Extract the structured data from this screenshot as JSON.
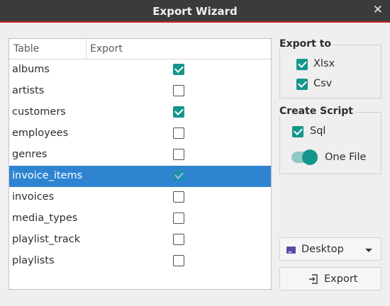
{
  "window": {
    "title": "Export Wizard",
    "close_glyph": "✕"
  },
  "table": {
    "headers": [
      "Table",
      "Export"
    ],
    "rows": [
      {
        "name": "albums",
        "checked": true
      },
      {
        "name": "artists",
        "checked": false
      },
      {
        "name": "customers",
        "checked": true
      },
      {
        "name": "employees",
        "checked": false
      },
      {
        "name": "genres",
        "checked": false
      },
      {
        "name": "invoice_items",
        "checked": true,
        "selected": true
      },
      {
        "name": "invoices",
        "checked": false
      },
      {
        "name": "media_types",
        "checked": false
      },
      {
        "name": "playlist_track",
        "checked": false
      },
      {
        "name": "playlists",
        "checked": false
      }
    ]
  },
  "export_to": {
    "title": "Export to",
    "options": [
      {
        "label": "Xlsx",
        "checked": true
      },
      {
        "label": "Csv",
        "checked": true
      }
    ]
  },
  "create_script": {
    "title": "Create Script",
    "sql": {
      "label": "Sql",
      "checked": true
    },
    "one_file": {
      "label": "One File",
      "on": true
    }
  },
  "destination": {
    "label": "Desktop",
    "icon": "folder-icon"
  },
  "export_button": {
    "label": "Export",
    "icon": "export-icon"
  },
  "colors": {
    "accent": "#14968c",
    "selection": "#2f84d2",
    "titlebar": "#3b3b3b",
    "titlebar_line": "#c8242c"
  }
}
